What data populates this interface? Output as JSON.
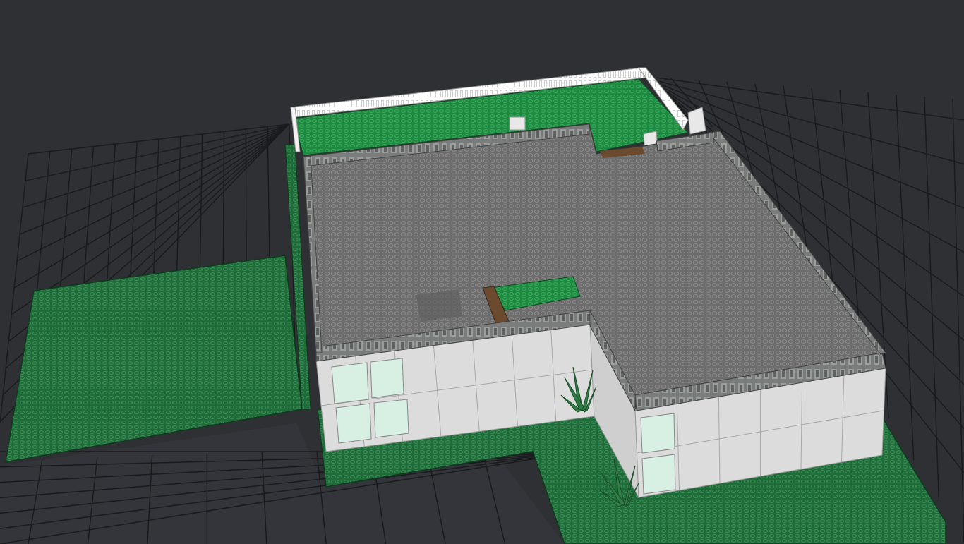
{
  "app": {
    "view": "3d-brick-model-viewport"
  },
  "scene": {
    "background_color": "#2e3033",
    "grid_line_color": "#1a1b1d",
    "grid_fill_color": "#3a3c3f",
    "baseplate_color": "#1f6b3a",
    "baseplate_stud_color": "#3a8e55",
    "lawn_color": "#1e8a3f",
    "roof_color": "#6d6d6d",
    "roof_stud_color": "#8a8a8a",
    "wall_color": "#dcdcdc",
    "window_color": "#d8efe4",
    "fence_color": "#f2f2f2",
    "soil_color": "#6b4a2e",
    "plant_color": "#2f7d45"
  },
  "objects": {
    "ground-grid": "grid-plane",
    "baseplate-left": "green-baseplate",
    "baseplate-front": "green-baseplate",
    "roof-garden": "green-lawn",
    "roof-terrace": "grey-roof",
    "fence": "white-fence",
    "plants": "green-plant"
  }
}
